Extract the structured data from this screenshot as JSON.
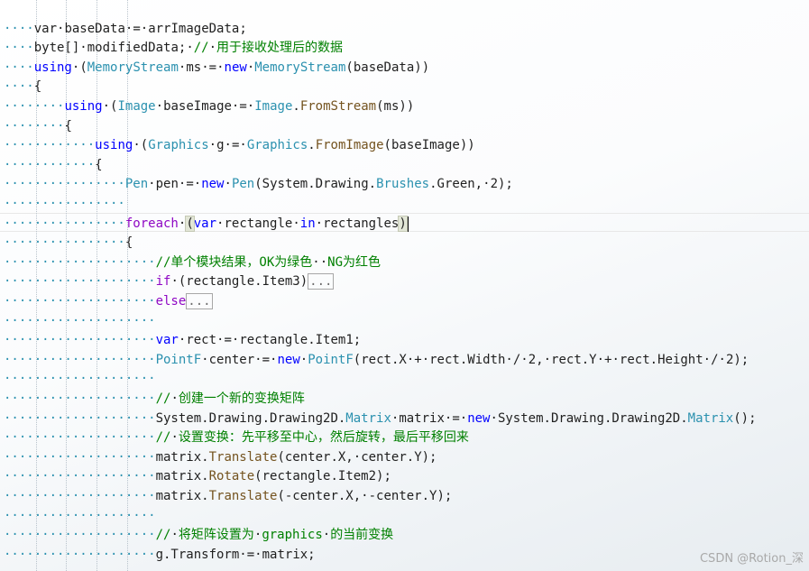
{
  "code_lines": [
    {
      "indent": 1,
      "tokens": [
        {
          "t": "text",
          "s": "var"
        },
        {
          "t": "ws",
          "s": "·"
        },
        {
          "t": "text",
          "s": "baseData"
        },
        {
          "t": "ws",
          "s": "·"
        },
        {
          "t": "text",
          "s": "="
        },
        {
          "t": "ws",
          "s": "·"
        },
        {
          "t": "text",
          "s": "arrImageData;"
        }
      ]
    },
    {
      "indent": 1,
      "tokens": [
        {
          "t": "text",
          "s": "byte[]"
        },
        {
          "t": "ws",
          "s": "·"
        },
        {
          "t": "text",
          "s": "modifiedData;"
        },
        {
          "t": "ws",
          "s": "·"
        },
        {
          "t": "comment",
          "s": "//"
        },
        {
          "t": "ws",
          "s": "·"
        },
        {
          "t": "comment",
          "s": "用于接收处理后的数据"
        }
      ]
    },
    {
      "indent": 1,
      "tokens": [
        {
          "t": "kw",
          "s": "using"
        },
        {
          "t": "ws",
          "s": "·"
        },
        {
          "t": "text",
          "s": "("
        },
        {
          "t": "type",
          "s": "MemoryStream"
        },
        {
          "t": "ws",
          "s": "·"
        },
        {
          "t": "text",
          "s": "ms"
        },
        {
          "t": "ws",
          "s": "·"
        },
        {
          "t": "text",
          "s": "="
        },
        {
          "t": "ws",
          "s": "·"
        },
        {
          "t": "kw",
          "s": "new"
        },
        {
          "t": "ws",
          "s": "·"
        },
        {
          "t": "type",
          "s": "MemoryStream"
        },
        {
          "t": "text",
          "s": "(baseData))"
        }
      ]
    },
    {
      "indent": 1,
      "tokens": [
        {
          "t": "text",
          "s": "{"
        }
      ]
    },
    {
      "indent": 2,
      "tokens": [
        {
          "t": "kw",
          "s": "using"
        },
        {
          "t": "ws",
          "s": "·"
        },
        {
          "t": "text",
          "s": "("
        },
        {
          "t": "type",
          "s": "Image"
        },
        {
          "t": "ws",
          "s": "·"
        },
        {
          "t": "text",
          "s": "baseImage"
        },
        {
          "t": "ws",
          "s": "·"
        },
        {
          "t": "text",
          "s": "="
        },
        {
          "t": "ws",
          "s": "·"
        },
        {
          "t": "type",
          "s": "Image"
        },
        {
          "t": "text",
          "s": "."
        },
        {
          "t": "method",
          "s": "FromStream"
        },
        {
          "t": "text",
          "s": "(ms))"
        }
      ]
    },
    {
      "indent": 2,
      "tokens": [
        {
          "t": "text",
          "s": "{"
        }
      ]
    },
    {
      "indent": 3,
      "tokens": [
        {
          "t": "kw",
          "s": "using"
        },
        {
          "t": "ws",
          "s": "·"
        },
        {
          "t": "text",
          "s": "("
        },
        {
          "t": "type",
          "s": "Graphics"
        },
        {
          "t": "ws",
          "s": "·"
        },
        {
          "t": "text",
          "s": "g"
        },
        {
          "t": "ws",
          "s": "·"
        },
        {
          "t": "text",
          "s": "="
        },
        {
          "t": "ws",
          "s": "·"
        },
        {
          "t": "type",
          "s": "Graphics"
        },
        {
          "t": "text",
          "s": "."
        },
        {
          "t": "method",
          "s": "FromImage"
        },
        {
          "t": "text",
          "s": "(baseImage))"
        }
      ]
    },
    {
      "indent": 3,
      "tokens": [
        {
          "t": "text",
          "s": "{"
        }
      ]
    },
    {
      "indent": 4,
      "tokens": [
        {
          "t": "type",
          "s": "Pen"
        },
        {
          "t": "ws",
          "s": "·"
        },
        {
          "t": "text",
          "s": "pen"
        },
        {
          "t": "ws",
          "s": "·"
        },
        {
          "t": "text",
          "s": "="
        },
        {
          "t": "ws",
          "s": "·"
        },
        {
          "t": "kw",
          "s": "new"
        },
        {
          "t": "ws",
          "s": "·"
        },
        {
          "t": "type",
          "s": "Pen"
        },
        {
          "t": "text",
          "s": "(System.Drawing."
        },
        {
          "t": "type",
          "s": "Brushes"
        },
        {
          "t": "text",
          "s": ".Green,"
        },
        {
          "t": "ws",
          "s": "·"
        },
        {
          "t": "text",
          "s": "2);"
        }
      ]
    },
    {
      "indent": 4,
      "tokens": []
    },
    {
      "indent": 4,
      "tokens": [
        {
          "t": "ctl",
          "s": "foreach"
        },
        {
          "t": "ws",
          "s": "·"
        },
        {
          "t": "bracket",
          "s": "("
        },
        {
          "t": "kw",
          "s": "var"
        },
        {
          "t": "ws",
          "s": "·"
        },
        {
          "t": "text",
          "s": "rectangle"
        },
        {
          "t": "ws",
          "s": "·"
        },
        {
          "t": "kw",
          "s": "in"
        },
        {
          "t": "ws",
          "s": "·"
        },
        {
          "t": "text",
          "s": "rectangles"
        },
        {
          "t": "bracket",
          "s": ")"
        }
      ]
    },
    {
      "indent": 4,
      "tokens": [
        {
          "t": "text",
          "s": "{"
        }
      ]
    },
    {
      "indent": 5,
      "tokens": [
        {
          "t": "comment",
          "s": "//单个模块结果，OK为绿色"
        },
        {
          "t": "ws",
          "s": "··"
        },
        {
          "t": "comment",
          "s": "NG为红色"
        }
      ]
    },
    {
      "indent": 5,
      "tokens": [
        {
          "t": "ctl",
          "s": "if"
        },
        {
          "t": "ws",
          "s": "·"
        },
        {
          "t": "text",
          "s": "(rectangle.Item3)"
        },
        {
          "t": "fold",
          "s": "..."
        }
      ]
    },
    {
      "indent": 5,
      "tokens": [
        {
          "t": "ctl",
          "s": "else"
        },
        {
          "t": "fold",
          "s": "..."
        }
      ]
    },
    {
      "indent": 5,
      "tokens": []
    },
    {
      "indent": 5,
      "tokens": [
        {
          "t": "kw",
          "s": "var"
        },
        {
          "t": "ws",
          "s": "·"
        },
        {
          "t": "text",
          "s": "rect"
        },
        {
          "t": "ws",
          "s": "·"
        },
        {
          "t": "text",
          "s": "="
        },
        {
          "t": "ws",
          "s": "·"
        },
        {
          "t": "text",
          "s": "rectangle.Item1;"
        }
      ]
    },
    {
      "indent": 5,
      "tokens": [
        {
          "t": "type",
          "s": "PointF"
        },
        {
          "t": "ws",
          "s": "·"
        },
        {
          "t": "text",
          "s": "center"
        },
        {
          "t": "ws",
          "s": "·"
        },
        {
          "t": "text",
          "s": "="
        },
        {
          "t": "ws",
          "s": "·"
        },
        {
          "t": "kw",
          "s": "new"
        },
        {
          "t": "ws",
          "s": "·"
        },
        {
          "t": "type",
          "s": "PointF"
        },
        {
          "t": "text",
          "s": "(rect.X"
        },
        {
          "t": "ws",
          "s": "·"
        },
        {
          "t": "text",
          "s": "+"
        },
        {
          "t": "ws",
          "s": "·"
        },
        {
          "t": "text",
          "s": "rect.Width"
        },
        {
          "t": "ws",
          "s": "·"
        },
        {
          "t": "text",
          "s": "/"
        },
        {
          "t": "ws",
          "s": "·"
        },
        {
          "t": "text",
          "s": "2,"
        },
        {
          "t": "ws",
          "s": "·"
        },
        {
          "t": "text",
          "s": "rect.Y"
        },
        {
          "t": "ws",
          "s": "·"
        },
        {
          "t": "text",
          "s": "+"
        },
        {
          "t": "ws",
          "s": "·"
        },
        {
          "t": "text",
          "s": "rect.Height"
        },
        {
          "t": "ws",
          "s": "·"
        },
        {
          "t": "text",
          "s": "/"
        },
        {
          "t": "ws",
          "s": "·"
        },
        {
          "t": "text",
          "s": "2);"
        }
      ]
    },
    {
      "indent": 5,
      "tokens": []
    },
    {
      "indent": 5,
      "tokens": [
        {
          "t": "comment",
          "s": "//"
        },
        {
          "t": "ws",
          "s": "·"
        },
        {
          "t": "comment",
          "s": "创建一个新的变换矩阵"
        }
      ]
    },
    {
      "indent": 5,
      "tokens": [
        {
          "t": "text",
          "s": "System.Drawing.Drawing2D."
        },
        {
          "t": "type",
          "s": "Matrix"
        },
        {
          "t": "ws",
          "s": "·"
        },
        {
          "t": "text",
          "s": "matrix"
        },
        {
          "t": "ws",
          "s": "·"
        },
        {
          "t": "text",
          "s": "="
        },
        {
          "t": "ws",
          "s": "·"
        },
        {
          "t": "kw",
          "s": "new"
        },
        {
          "t": "ws",
          "s": "·"
        },
        {
          "t": "text",
          "s": "System.Drawing.Drawing2D."
        },
        {
          "t": "type",
          "s": "Matrix"
        },
        {
          "t": "text",
          "s": "();"
        }
      ]
    },
    {
      "indent": 5,
      "tokens": [
        {
          "t": "comment",
          "s": "//"
        },
        {
          "t": "ws",
          "s": "·"
        },
        {
          "t": "comment",
          "s": "设置变换：先平移至中心，然后旋转，最后平移回来"
        }
      ]
    },
    {
      "indent": 5,
      "tokens": [
        {
          "t": "text",
          "s": "matrix."
        },
        {
          "t": "method",
          "s": "Translate"
        },
        {
          "t": "text",
          "s": "(center.X,"
        },
        {
          "t": "ws",
          "s": "·"
        },
        {
          "t": "text",
          "s": "center.Y);"
        }
      ]
    },
    {
      "indent": 5,
      "tokens": [
        {
          "t": "text",
          "s": "matrix."
        },
        {
          "t": "method",
          "s": "Rotate"
        },
        {
          "t": "text",
          "s": "(rectangle.Item2);"
        }
      ]
    },
    {
      "indent": 5,
      "tokens": [
        {
          "t": "text",
          "s": "matrix."
        },
        {
          "t": "method",
          "s": "Translate"
        },
        {
          "t": "text",
          "s": "(-center.X,"
        },
        {
          "t": "ws",
          "s": "·"
        },
        {
          "t": "text",
          "s": "-center.Y);"
        }
      ]
    },
    {
      "indent": 5,
      "tokens": []
    },
    {
      "indent": 5,
      "tokens": [
        {
          "t": "comment",
          "s": "//"
        },
        {
          "t": "ws",
          "s": "·"
        },
        {
          "t": "comment",
          "s": "将矩阵设置为"
        },
        {
          "t": "ws",
          "s": "·"
        },
        {
          "t": "comment",
          "s": "graphics"
        },
        {
          "t": "ws",
          "s": "·"
        },
        {
          "t": "comment",
          "s": "的当前变换"
        }
      ]
    },
    {
      "indent": 5,
      "tokens": [
        {
          "t": "text",
          "s": "g.Transform"
        },
        {
          "t": "ws",
          "s": "·"
        },
        {
          "t": "text",
          "s": "="
        },
        {
          "t": "ws",
          "s": "·"
        },
        {
          "t": "text",
          "s": "matrix;"
        }
      ]
    }
  ],
  "colors": {
    "keyword": "#0000ff",
    "control_keyword": "#8f08c4",
    "type": "#2b91af",
    "method": "#74531f",
    "comment": "#008000",
    "text": "#1f1f1f",
    "whitespace_marker": "#2b91af"
  },
  "watermark": "CSDN @Rotion_深"
}
